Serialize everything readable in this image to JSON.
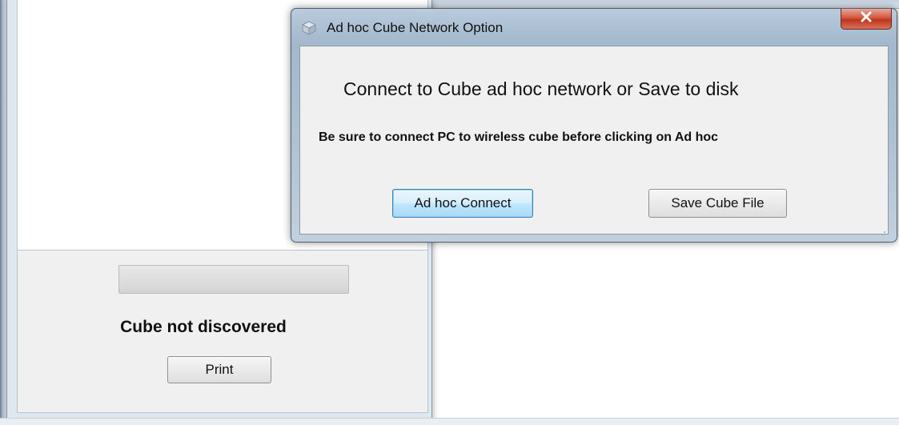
{
  "main_window": {
    "progress_fraction": 0,
    "status_text": "Cube not discovered",
    "print_label": "Print"
  },
  "dialog": {
    "title": "Ad hoc Cube Network Option",
    "heading": "Connect to Cube ad hoc network or Save to disk",
    "warning": "Be sure to connect PC to wireless cube before clicking on Ad hoc",
    "adhoc_connect_label": "Ad hoc Connect",
    "save_cube_file_label": "Save Cube File",
    "close_icon": "close-icon",
    "app_icon": "cube-app-icon"
  },
  "colors": {
    "close_button": "#c7432c",
    "focused_button_border": "#3c7fb1",
    "dialog_frame": "#a3b8cd"
  }
}
